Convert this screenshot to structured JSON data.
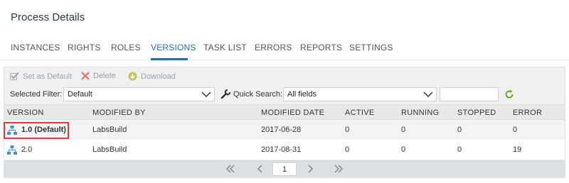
{
  "page": {
    "title": "Process Details"
  },
  "tabs": [
    {
      "label": "INSTANCES"
    },
    {
      "label": "RIGHTS"
    },
    {
      "label": "ROLES"
    },
    {
      "label": "VERSIONS",
      "active": true
    },
    {
      "label": "TASK LIST"
    },
    {
      "label": "ERRORS"
    },
    {
      "label": "REPORTS"
    },
    {
      "label": "SETTINGS"
    }
  ],
  "toolbar": {
    "set_default": "Set as Default",
    "delete": "Delete",
    "download": "Download"
  },
  "filter": {
    "selected_label": "Selected Filter:",
    "selected_value": "Default",
    "quick_label": "Quick Search:",
    "quick_value": "All fields",
    "search_text": ""
  },
  "grid": {
    "columns": [
      "VERSION",
      "MODIFIED BY",
      "MODIFIED DATE",
      "ACTIVE",
      "RUNNING",
      "STOPPED",
      "ERROR"
    ],
    "rows": [
      {
        "version": "1.0 (Default)",
        "modified_by": "LabsBuild",
        "modified_date": "2017-06-28",
        "active": "0",
        "running": "0",
        "stopped": "0",
        "error": "0"
      },
      {
        "version": "2.0",
        "modified_by": "LabsBuild",
        "modified_date": "2017-08-31",
        "active": "0",
        "running": "0",
        "stopped": "0",
        "error": "19"
      }
    ]
  },
  "pager": {
    "page": "1"
  },
  "colors": {
    "accent": "#1f6fb5",
    "highlight": "#e0393e",
    "refresh": "#6aa12a"
  },
  "icons": [
    "checkmark-icon",
    "delete-x-icon",
    "download-icon",
    "wrench-icon",
    "refresh-icon",
    "process-icon",
    "chevron-down-icon"
  ]
}
